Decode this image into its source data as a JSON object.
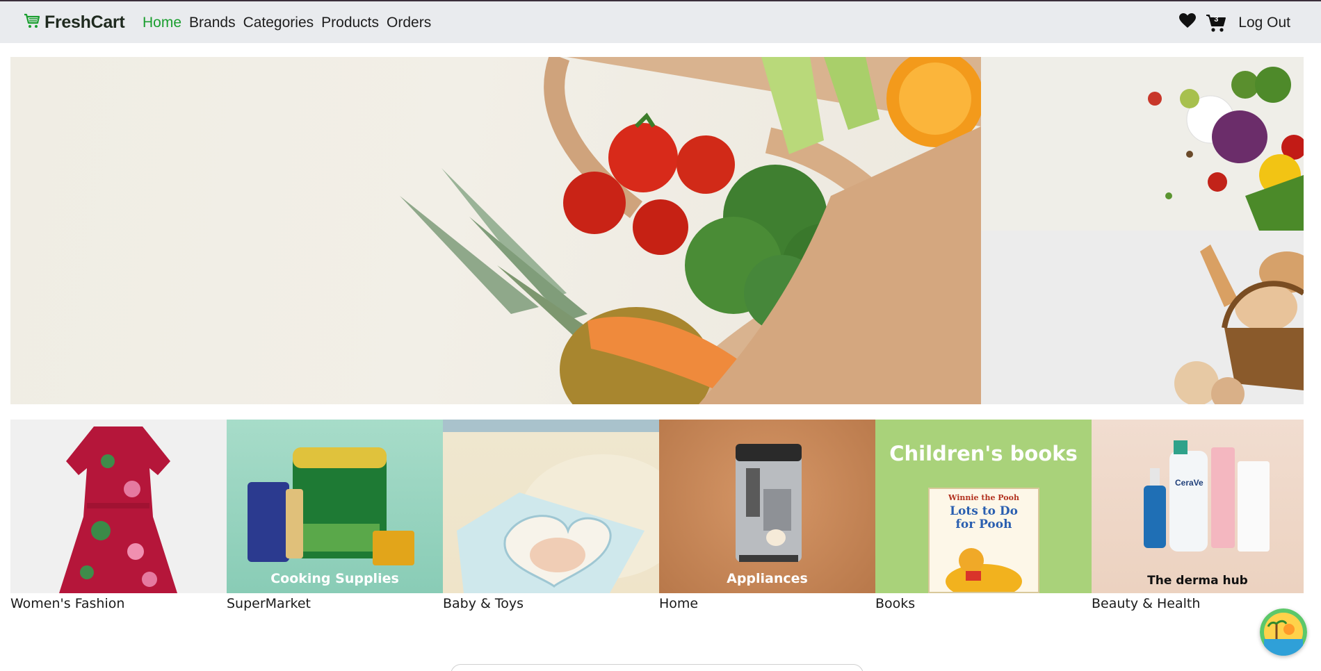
{
  "navbar": {
    "brand": "FreshCart",
    "links": [
      {
        "label": "Home",
        "active": true
      },
      {
        "label": "Brands",
        "active": false
      },
      {
        "label": "Categories",
        "active": false
      },
      {
        "label": "Products",
        "active": false
      },
      {
        "label": "Orders",
        "active": false
      }
    ],
    "cart_count": "3",
    "logout_label": "Log Out"
  },
  "colors": {
    "accent_green": "#1a9e2f",
    "navbar_bg": "#e9ebee"
  },
  "hero": {
    "main_image": "grocery-bag-with-vegetables",
    "side_top_image": "fresh-vegetables",
    "side_bottom_image": "bread-basket"
  },
  "categories": [
    {
      "name": "Women's Fashion",
      "caption": "",
      "image": "red-floral-dress"
    },
    {
      "name": "SuperMarket",
      "caption": "Cooking Supplies",
      "image": "groceries"
    },
    {
      "name": "Baby & Toys",
      "caption": "",
      "image": "pampers-diapers"
    },
    {
      "name": "Home",
      "caption": "Appliances",
      "image": "coffee-machine"
    },
    {
      "name": "Books",
      "caption": "Children's books",
      "book_title": "Lots to Do for Pooh",
      "book_brand": "Winnie the Pooh",
      "image": "childrens-book"
    },
    {
      "name": "Beauty & Health",
      "caption": "The derma hub",
      "image": "skincare-bottles",
      "product_brand": "CeraVe"
    }
  ],
  "icons": {
    "brand": "cart-logo-icon",
    "wishlist": "heart-icon",
    "cart": "cart-icon",
    "chat": "chat-widget-icon"
  }
}
